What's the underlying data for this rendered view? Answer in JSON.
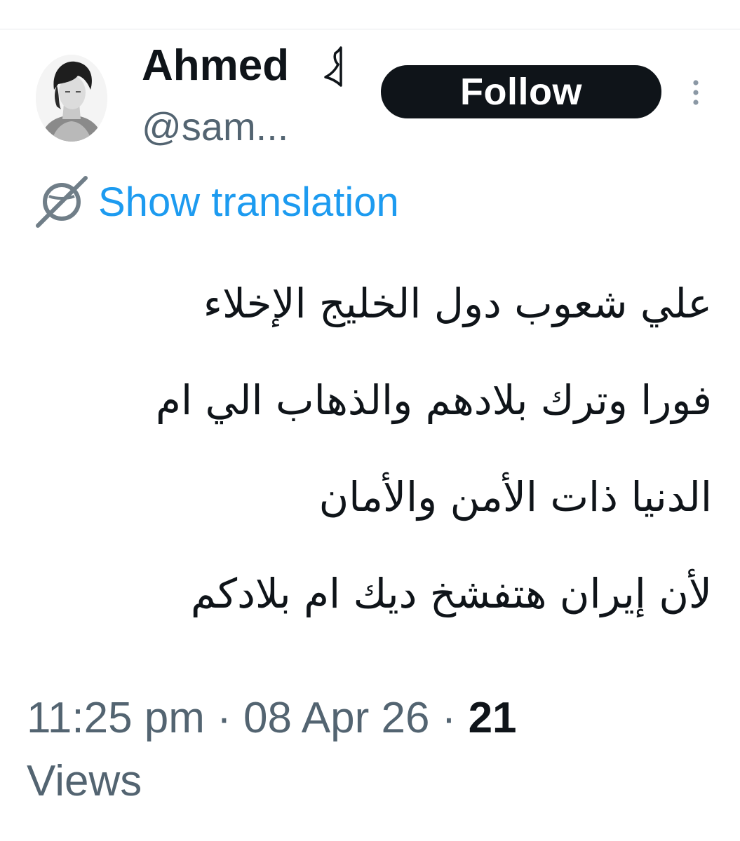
{
  "author": {
    "display_name": "Ahmed",
    "handle": "@sam..."
  },
  "actions": {
    "follow_label": "Follow",
    "more_icon": "more-vertical-icon"
  },
  "translation": {
    "label": "Show translation",
    "icon": "globe-icon"
  },
  "tweet": {
    "lines": [
      "علي شعوب دول الخليج الإخلاء",
      "فورا وترك بلادهم والذهاب الي ام",
      "الدنيا ذات الأمن والأمان",
      "لأن إيران هتفشخ ديك ام بلادكم"
    ]
  },
  "meta": {
    "time": "11:25 pm",
    "separator": " · ",
    "date": "08 Apr 26",
    "views_count": "21",
    "views_label": "Views"
  },
  "colors": {
    "link": "#1d9bf0",
    "secondary_text": "#536471",
    "primary_text": "#0f1419",
    "follow_bg": "#0f1419"
  }
}
